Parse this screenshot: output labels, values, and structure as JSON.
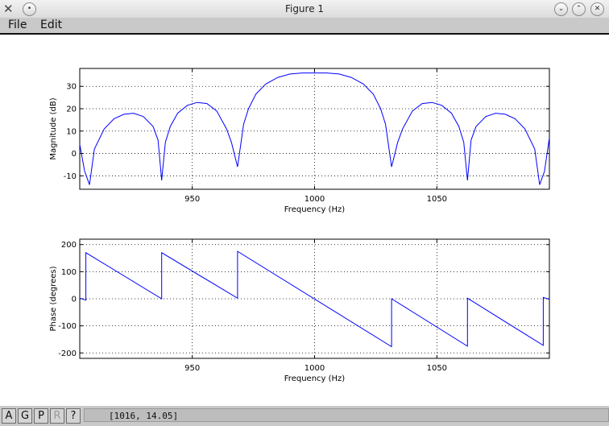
{
  "window": {
    "title": "Figure 1"
  },
  "menu": {
    "file": "File",
    "edit": "Edit"
  },
  "toolbar": {
    "buttons": [
      "A",
      "G",
      "P",
      "R",
      "?"
    ]
  },
  "status": {
    "coords": "[1016,  14.05]"
  },
  "chart_data": [
    {
      "type": "line",
      "xlabel": "Frequency (Hz)",
      "ylabel": "Magnitude (dB)",
      "xlim": [
        904,
        1096
      ],
      "ylim": [
        -16,
        38
      ],
      "xticks": [
        950,
        1000,
        1050
      ],
      "yticks": [
        -10,
        0,
        10,
        20,
        30
      ],
      "grid": true,
      "color": "#0000ff",
      "series": [
        {
          "x": [
            904,
            906,
            908,
            910,
            914,
            918,
            922,
            926,
            930,
            934,
            936,
            937.5,
            939,
            941,
            944,
            948,
            952,
            956,
            960,
            964,
            966,
            968.5,
            971,
            973,
            976,
            980,
            985,
            990,
            995,
            1000,
            1005,
            1010,
            1015,
            1020,
            1024,
            1027,
            1029,
            1031.5,
            1034,
            1036,
            1040,
            1044,
            1048,
            1052,
            1056,
            1059,
            1061,
            1062.5,
            1064,
            1066,
            1070,
            1074,
            1078,
            1082,
            1086,
            1090,
            1092,
            1094,
            1096
          ],
          "y": [
            4,
            -8,
            -14,
            2,
            11,
            15.5,
            17.5,
            18,
            16.5,
            12,
            6,
            -12,
            5,
            12,
            18,
            21.5,
            22.8,
            22.3,
            19,
            11,
            5,
            -6,
            13,
            20,
            26.5,
            31,
            34,
            35.5,
            36,
            36,
            36,
            35.5,
            34,
            31,
            26.5,
            20,
            13,
            -6,
            5,
            11,
            19,
            22.3,
            22.8,
            21.5,
            18,
            12,
            5,
            -12,
            6,
            12,
            16.5,
            18,
            17.5,
            15.5,
            11,
            2,
            -14,
            -8,
            7
          ]
        }
      ]
    },
    {
      "type": "line",
      "xlabel": "Frequency (Hz)",
      "ylabel": "Phase (degrees)",
      "xlim": [
        904,
        1096
      ],
      "ylim": [
        -220,
        220
      ],
      "xticks": [
        950,
        1000,
        1050
      ],
      "yticks": [
        -200,
        -100,
        0,
        100,
        200
      ],
      "grid": true,
      "color": "#0000ff",
      "series": [
        {
          "x": [
            904,
            906.5,
            906.5,
            937.5,
            937.5,
            968.5,
            968.5,
            1031.5,
            1031.5,
            1062.5,
            1062.5,
            1093.5,
            1093.5,
            1096
          ],
          "y": [
            2,
            -5,
            170,
            0,
            170,
            2,
            175,
            -177,
            0,
            -175,
            2,
            -172,
            5,
            -2
          ]
        }
      ]
    }
  ]
}
